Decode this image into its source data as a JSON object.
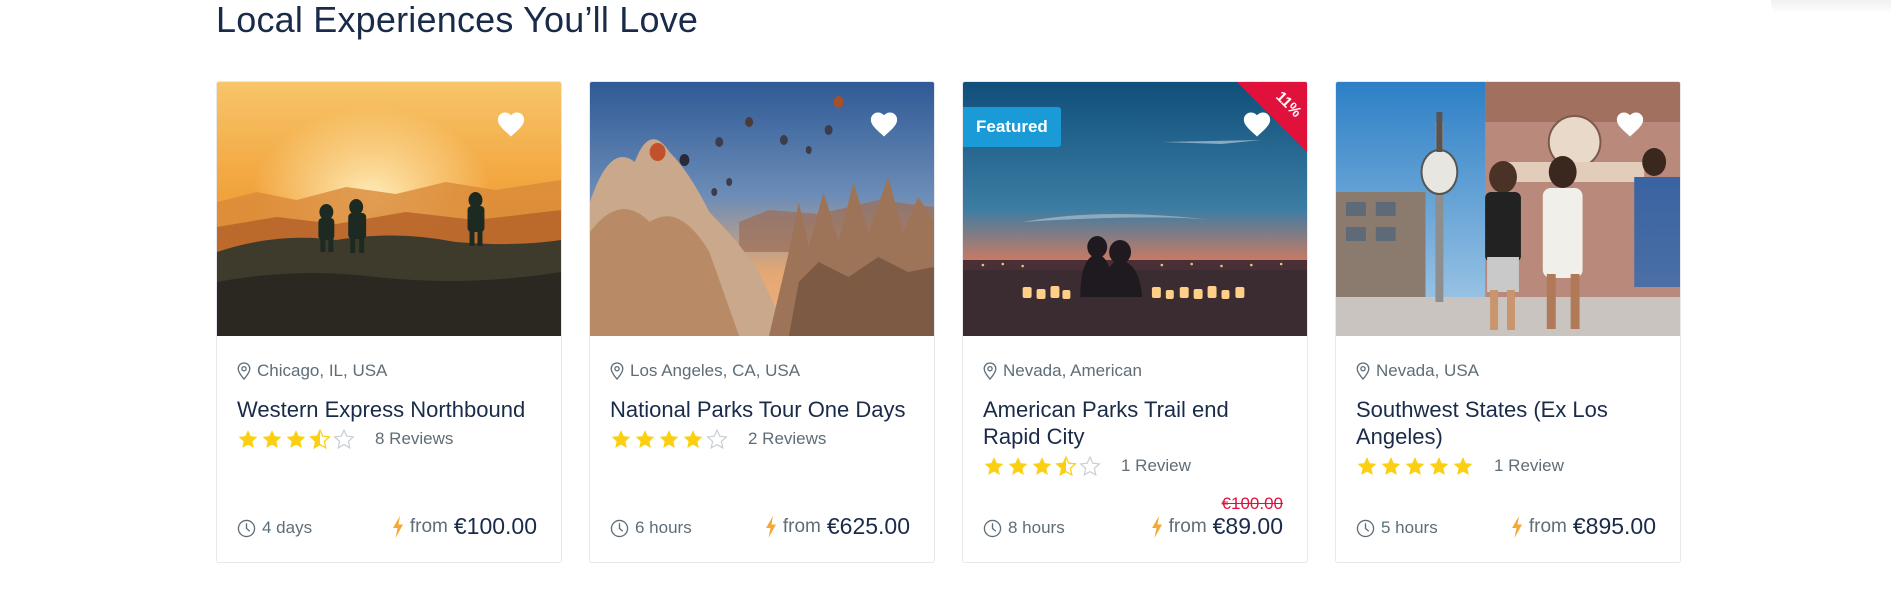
{
  "section": {
    "title": "Local Experiences You’ll Love"
  },
  "cards": [
    {
      "location": "Chicago, IL, USA",
      "title": "Western Express Northbound",
      "rating": 3.5,
      "reviews": "8 Reviews",
      "duration": "4 days",
      "from_label": "from",
      "price": "€100.00",
      "old_price": "",
      "badge": "",
      "discount": "",
      "image": "hikers-at-sunset"
    },
    {
      "location": "Los Angeles, CA, USA",
      "title": "National Parks Tour One Days",
      "rating": 4,
      "reviews": "2 Reviews",
      "duration": "6 hours",
      "from_label": "from",
      "price": "€625.00",
      "old_price": "",
      "badge": "",
      "discount": "",
      "image": "balloons-over-rock-valley"
    },
    {
      "location": "Nevada, American",
      "title": "American Parks Trail end Rapid City",
      "rating": 3.5,
      "reviews": "1 Review",
      "duration": "8 hours",
      "from_label": "from",
      "price": "€89.00",
      "old_price": "€100.00",
      "badge": "Featured",
      "discount": "11%",
      "image": "couple-with-candles-at-dusk"
    },
    {
      "location": "Nevada, USA",
      "title": "Southwest States (Ex Los Angeles)",
      "rating": 5,
      "reviews": "1 Review",
      "duration": "5 hours",
      "from_label": "from",
      "price": "€895.00",
      "old_price": "",
      "badge": "",
      "discount": "",
      "image": "friends-walking-street"
    }
  ],
  "colors": {
    "star": "#fcd012",
    "accent_orange": "#f7a833",
    "featured_blue": "#1a9bd7",
    "discount_red": "#e0123c",
    "title_navy": "#1a2b49",
    "muted_text": "#5e6d77"
  },
  "icons": {
    "location": "map-pin-icon",
    "wishlist": "heart-icon",
    "duration": "clock-icon",
    "price": "lightning-icon",
    "star": "star-icon"
  }
}
